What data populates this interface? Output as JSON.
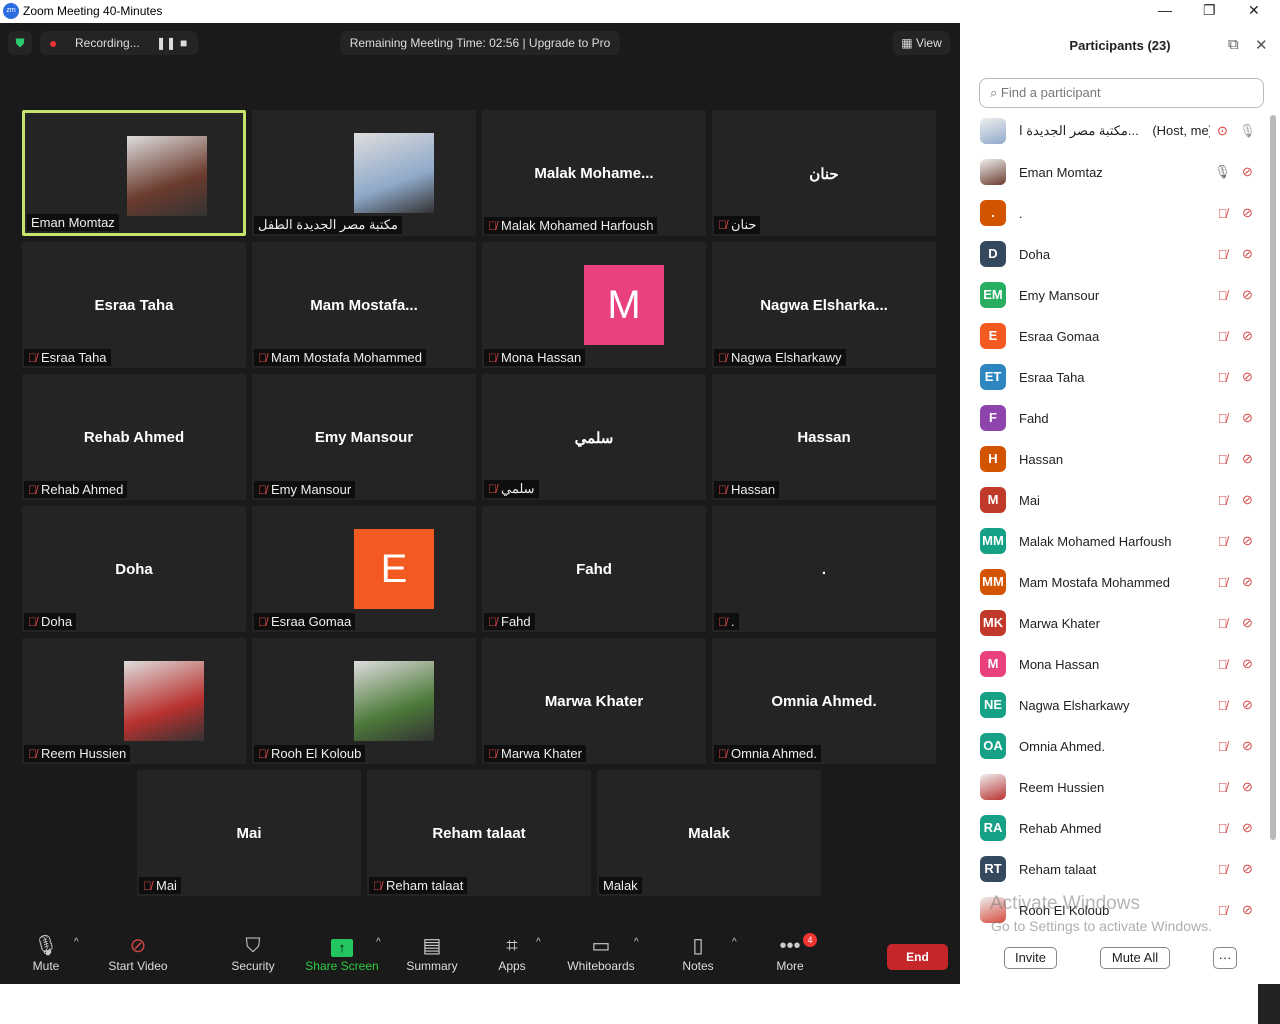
{
  "window": {
    "title": "Zoom Meeting 40-Minutes",
    "logo": "zm"
  },
  "topbar": {
    "recording": "Recording...",
    "remaining": "Remaining Meeting Time: 02:56 | Upgrade to Pro",
    "view": "View"
  },
  "tiles": [
    {
      "big": "",
      "label": "Eman Momtaz",
      "photo": "#6b3b2e",
      "active": true,
      "muted": false
    },
    {
      "big": "",
      "label": "مكتبة مصر الجديدة الطفل",
      "photo": "#8fa9c9",
      "muted": false
    },
    {
      "big": "Malak  Mohame...",
      "label": "Malak Mohamed Harfoush",
      "muted": true
    },
    {
      "big": "حنان",
      "label": "حنان",
      "muted": true
    },
    {
      "big": "Esraa Taha",
      "label": "Esraa Taha",
      "muted": true
    },
    {
      "big": "Mam  Mostafa...",
      "label": "Mam Mostafa Mohammed",
      "muted": true
    },
    {
      "big": "",
      "avatar": "M",
      "avatarColor": "#e8417e",
      "label": "Mona Hassan",
      "muted": true
    },
    {
      "big": "Nagwa  Elsharka...",
      "label": "Nagwa Elsharkawy",
      "muted": true
    },
    {
      "big": "Rehab Ahmed",
      "label": "Rehab Ahmed",
      "muted": true
    },
    {
      "big": "Emy Mansour",
      "label": "Emy Mansour",
      "muted": true
    },
    {
      "big": "سلمي",
      "label": "سلمي",
      "muted": true
    },
    {
      "big": "Hassan",
      "label": "Hassan",
      "muted": true
    },
    {
      "big": "Doha",
      "label": "Doha",
      "muted": true
    },
    {
      "big": "",
      "avatar": "E",
      "avatarColor": "#f25a22",
      "label": "Esraa Gomaa",
      "muted": true
    },
    {
      "big": "Fahd",
      "label": "Fahd",
      "muted": true
    },
    {
      "big": ".",
      "label": ".",
      "muted": true
    },
    {
      "big": "",
      "label": "Reem Hussien",
      "photo": "#b8322f",
      "muted": true
    },
    {
      "big": "",
      "label": "Rooh El Koloub",
      "photo": "#4d7a3a",
      "muted": true
    },
    {
      "big": "Marwa Khater",
      "label": "Marwa Khater",
      "muted": true
    },
    {
      "big": "Omnia Ahmed.",
      "label": "Omnia Ahmed.",
      "muted": true
    },
    {
      "big": "Mai",
      "label": "Mai",
      "muted": true
    },
    {
      "big": "Reham talaat",
      "label": "Reham talaat",
      "muted": true
    },
    {
      "big": "Malak",
      "label": "Malak",
      "muted": false
    }
  ],
  "toolbar": {
    "items": [
      "Mute",
      "Start Video",
      "Security",
      "Share Screen",
      "Summary",
      "Apps",
      "Whiteboards",
      "Notes",
      "More"
    ],
    "more_badge": "4",
    "end": "End"
  },
  "panel": {
    "title": "Participants (23)",
    "search_placeholder": "Find a participant",
    "participants": [
      {
        "name": "مكتبة مصر الجديدة ا...",
        "tag": "(Host, me)",
        "initials": "",
        "color": "#8fa9c9"
      },
      {
        "name": "Eman Momtaz",
        "initials": "",
        "color": "#6b3b2e"
      },
      {
        "name": ".",
        "initials": ".",
        "color": "#d35400"
      },
      {
        "name": "Doha",
        "initials": "D",
        "color": "#34495e"
      },
      {
        "name": "Emy Mansour",
        "initials": "EM",
        "color": "#27ae60"
      },
      {
        "name": "Esraa Gomaa",
        "initials": "E",
        "color": "#f25a22"
      },
      {
        "name": "Esraa Taha",
        "initials": "ET",
        "color": "#2e86c1"
      },
      {
        "name": "Fahd",
        "initials": "F",
        "color": "#8e44ad"
      },
      {
        "name": "Hassan",
        "initials": "H",
        "color": "#d35400"
      },
      {
        "name": "Mai",
        "initials": "M",
        "color": "#c0392b"
      },
      {
        "name": "Malak Mohamed Harfoush",
        "initials": "MM",
        "color": "#16a085"
      },
      {
        "name": "Mam Mostafa Mohammed",
        "initials": "MM",
        "color": "#d35400"
      },
      {
        "name": "Marwa Khater",
        "initials": "MK",
        "color": "#c0392b"
      },
      {
        "name": "Mona Hassan",
        "initials": "M",
        "color": "#e8417e"
      },
      {
        "name": "Nagwa Elsharkawy",
        "initials": "NE",
        "color": "#16a085"
      },
      {
        "name": "Omnia Ahmed.",
        "initials": "OA",
        "color": "#16a085"
      },
      {
        "name": "Reem Hussien",
        "initials": "",
        "color": "#b8322f"
      },
      {
        "name": "Rehab Ahmed",
        "initials": "RA",
        "color": "#16a085"
      },
      {
        "name": "Reham talaat",
        "initials": "RT",
        "color": "#34495e"
      },
      {
        "name": "Rooh El Koloub",
        "initials": "",
        "color": "#d64a3a"
      }
    ],
    "invite": "Invite",
    "mute_all": "Mute All",
    "more": "···"
  },
  "watermark": {
    "line1": "Activate Windows",
    "line2": "Go to Settings to activate Windows."
  }
}
